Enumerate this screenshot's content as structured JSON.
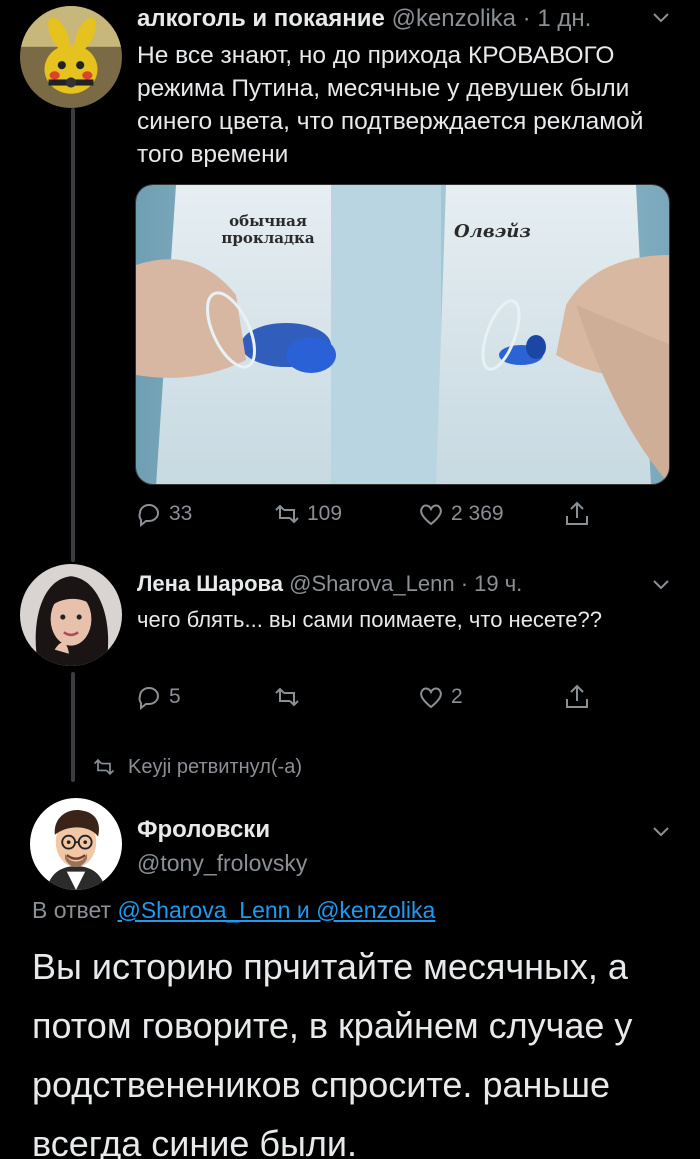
{
  "tweet1": {
    "author_name": "алкоголь и покаяние",
    "handle": "@kenzolika",
    "time": "· 1 дн.",
    "text": "Не все знают, но до прихода КРОВАВОГО режима Путина, месячные у девушек были синего цвета, что подтверждается рекламой того времени",
    "image": {
      "label_left": "обычная прокладка",
      "label_right": "Олвэйз"
    },
    "replies": "33",
    "retweets": "109",
    "likes": "2 369"
  },
  "tweet2": {
    "author_name": "Лена Шарова",
    "handle": "@Sharova_Lenn",
    "time": "· 19 ч.",
    "text": "чего блять... вы сами поимаете, что несете??",
    "replies": "5",
    "retweets": "",
    "likes": "2"
  },
  "retweet_note": "Keyji ретвитнул(-а)",
  "tweet3": {
    "author_name": "Фроловски",
    "handle": "@tony_frolovsky",
    "reply_prefix": "В ответ",
    "reply_to": "@Sharova_Lenn и @kenzolika",
    "text": "Вы историю прчитайте месячных, а потом говорите, в крайнем случае у родственеников спросите. раньше всегда синие были."
  },
  "colors": {
    "background": "#000000",
    "text": "#e7e9ea",
    "muted": "#8b9095",
    "link": "#1d9bf0",
    "thread_line": "#3a3d40"
  },
  "icons": [
    "reply-icon",
    "retweet-icon",
    "like-icon",
    "share-icon",
    "chevron-down-icon"
  ]
}
